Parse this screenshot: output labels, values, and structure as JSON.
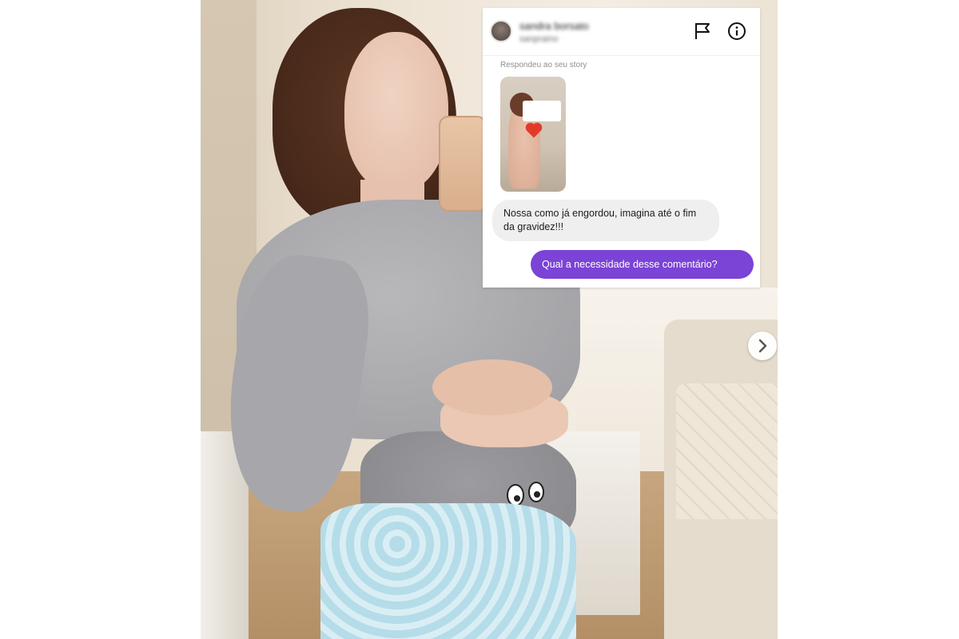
{
  "dm": {
    "name": "sandra borsato",
    "handle": "sanpraino",
    "reply_label": "Respondeu ao seu story",
    "incoming_message": "Nossa como já engordou, imagina até o fim da gravidez!!!",
    "outgoing_message": "Qual a necessidade desse comentário?"
  },
  "icons": {
    "flag": "flag-icon",
    "info": "info-icon",
    "next": "chevron-right-icon"
  },
  "colors": {
    "outgoing_bubble": "#7b43d6",
    "incoming_bubble": "#efefef"
  }
}
